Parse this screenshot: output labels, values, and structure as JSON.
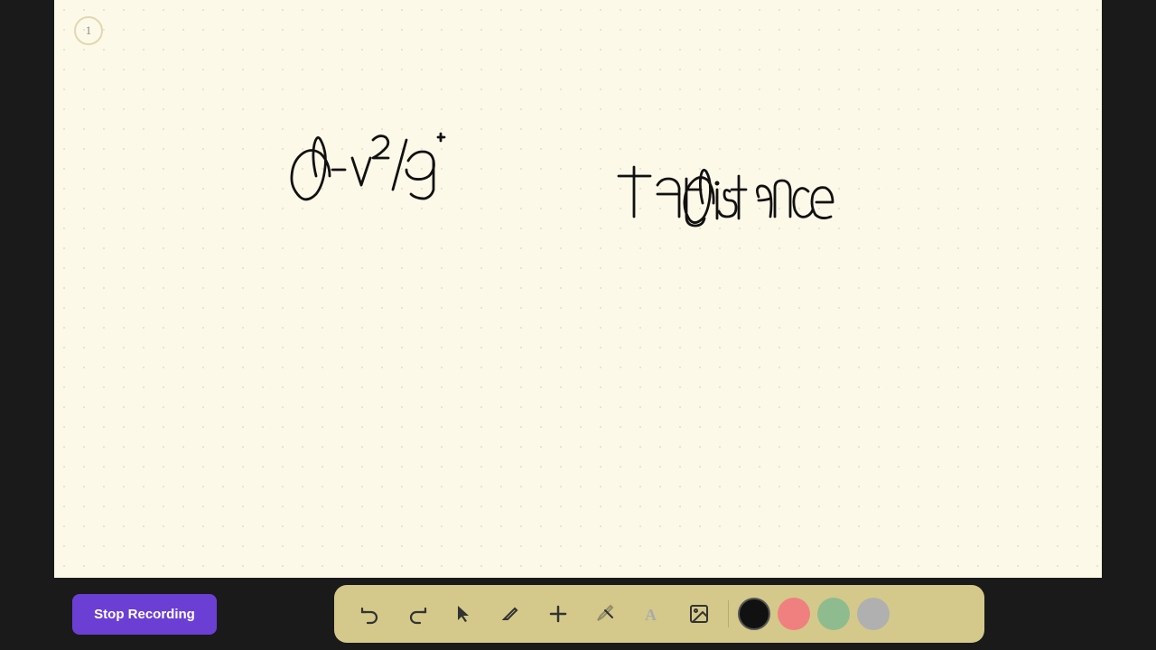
{
  "page": {
    "number": "1",
    "background_color": "#fdf9e8"
  },
  "stop_recording": {
    "label": "Stop Recording",
    "bg_color": "#6b3fd4"
  },
  "toolbar": {
    "tools": [
      {
        "name": "undo",
        "icon": "↩",
        "label": "Undo"
      },
      {
        "name": "redo",
        "icon": "↪",
        "label": "Redo"
      },
      {
        "name": "select",
        "icon": "▲",
        "label": "Select"
      },
      {
        "name": "pen",
        "icon": "✏",
        "label": "Pen"
      },
      {
        "name": "add",
        "icon": "+",
        "label": "Add"
      },
      {
        "name": "eraser",
        "icon": "⌫",
        "label": "Eraser"
      },
      {
        "name": "text",
        "icon": "A",
        "label": "Text"
      },
      {
        "name": "image",
        "icon": "🖼",
        "label": "Image"
      }
    ],
    "colors": [
      {
        "name": "black",
        "value": "#111111",
        "active": true
      },
      {
        "name": "pink",
        "value": "#f08080"
      },
      {
        "name": "green",
        "value": "#8fbc8f"
      },
      {
        "name": "gray",
        "value": "#b0b0b0"
      }
    ]
  }
}
